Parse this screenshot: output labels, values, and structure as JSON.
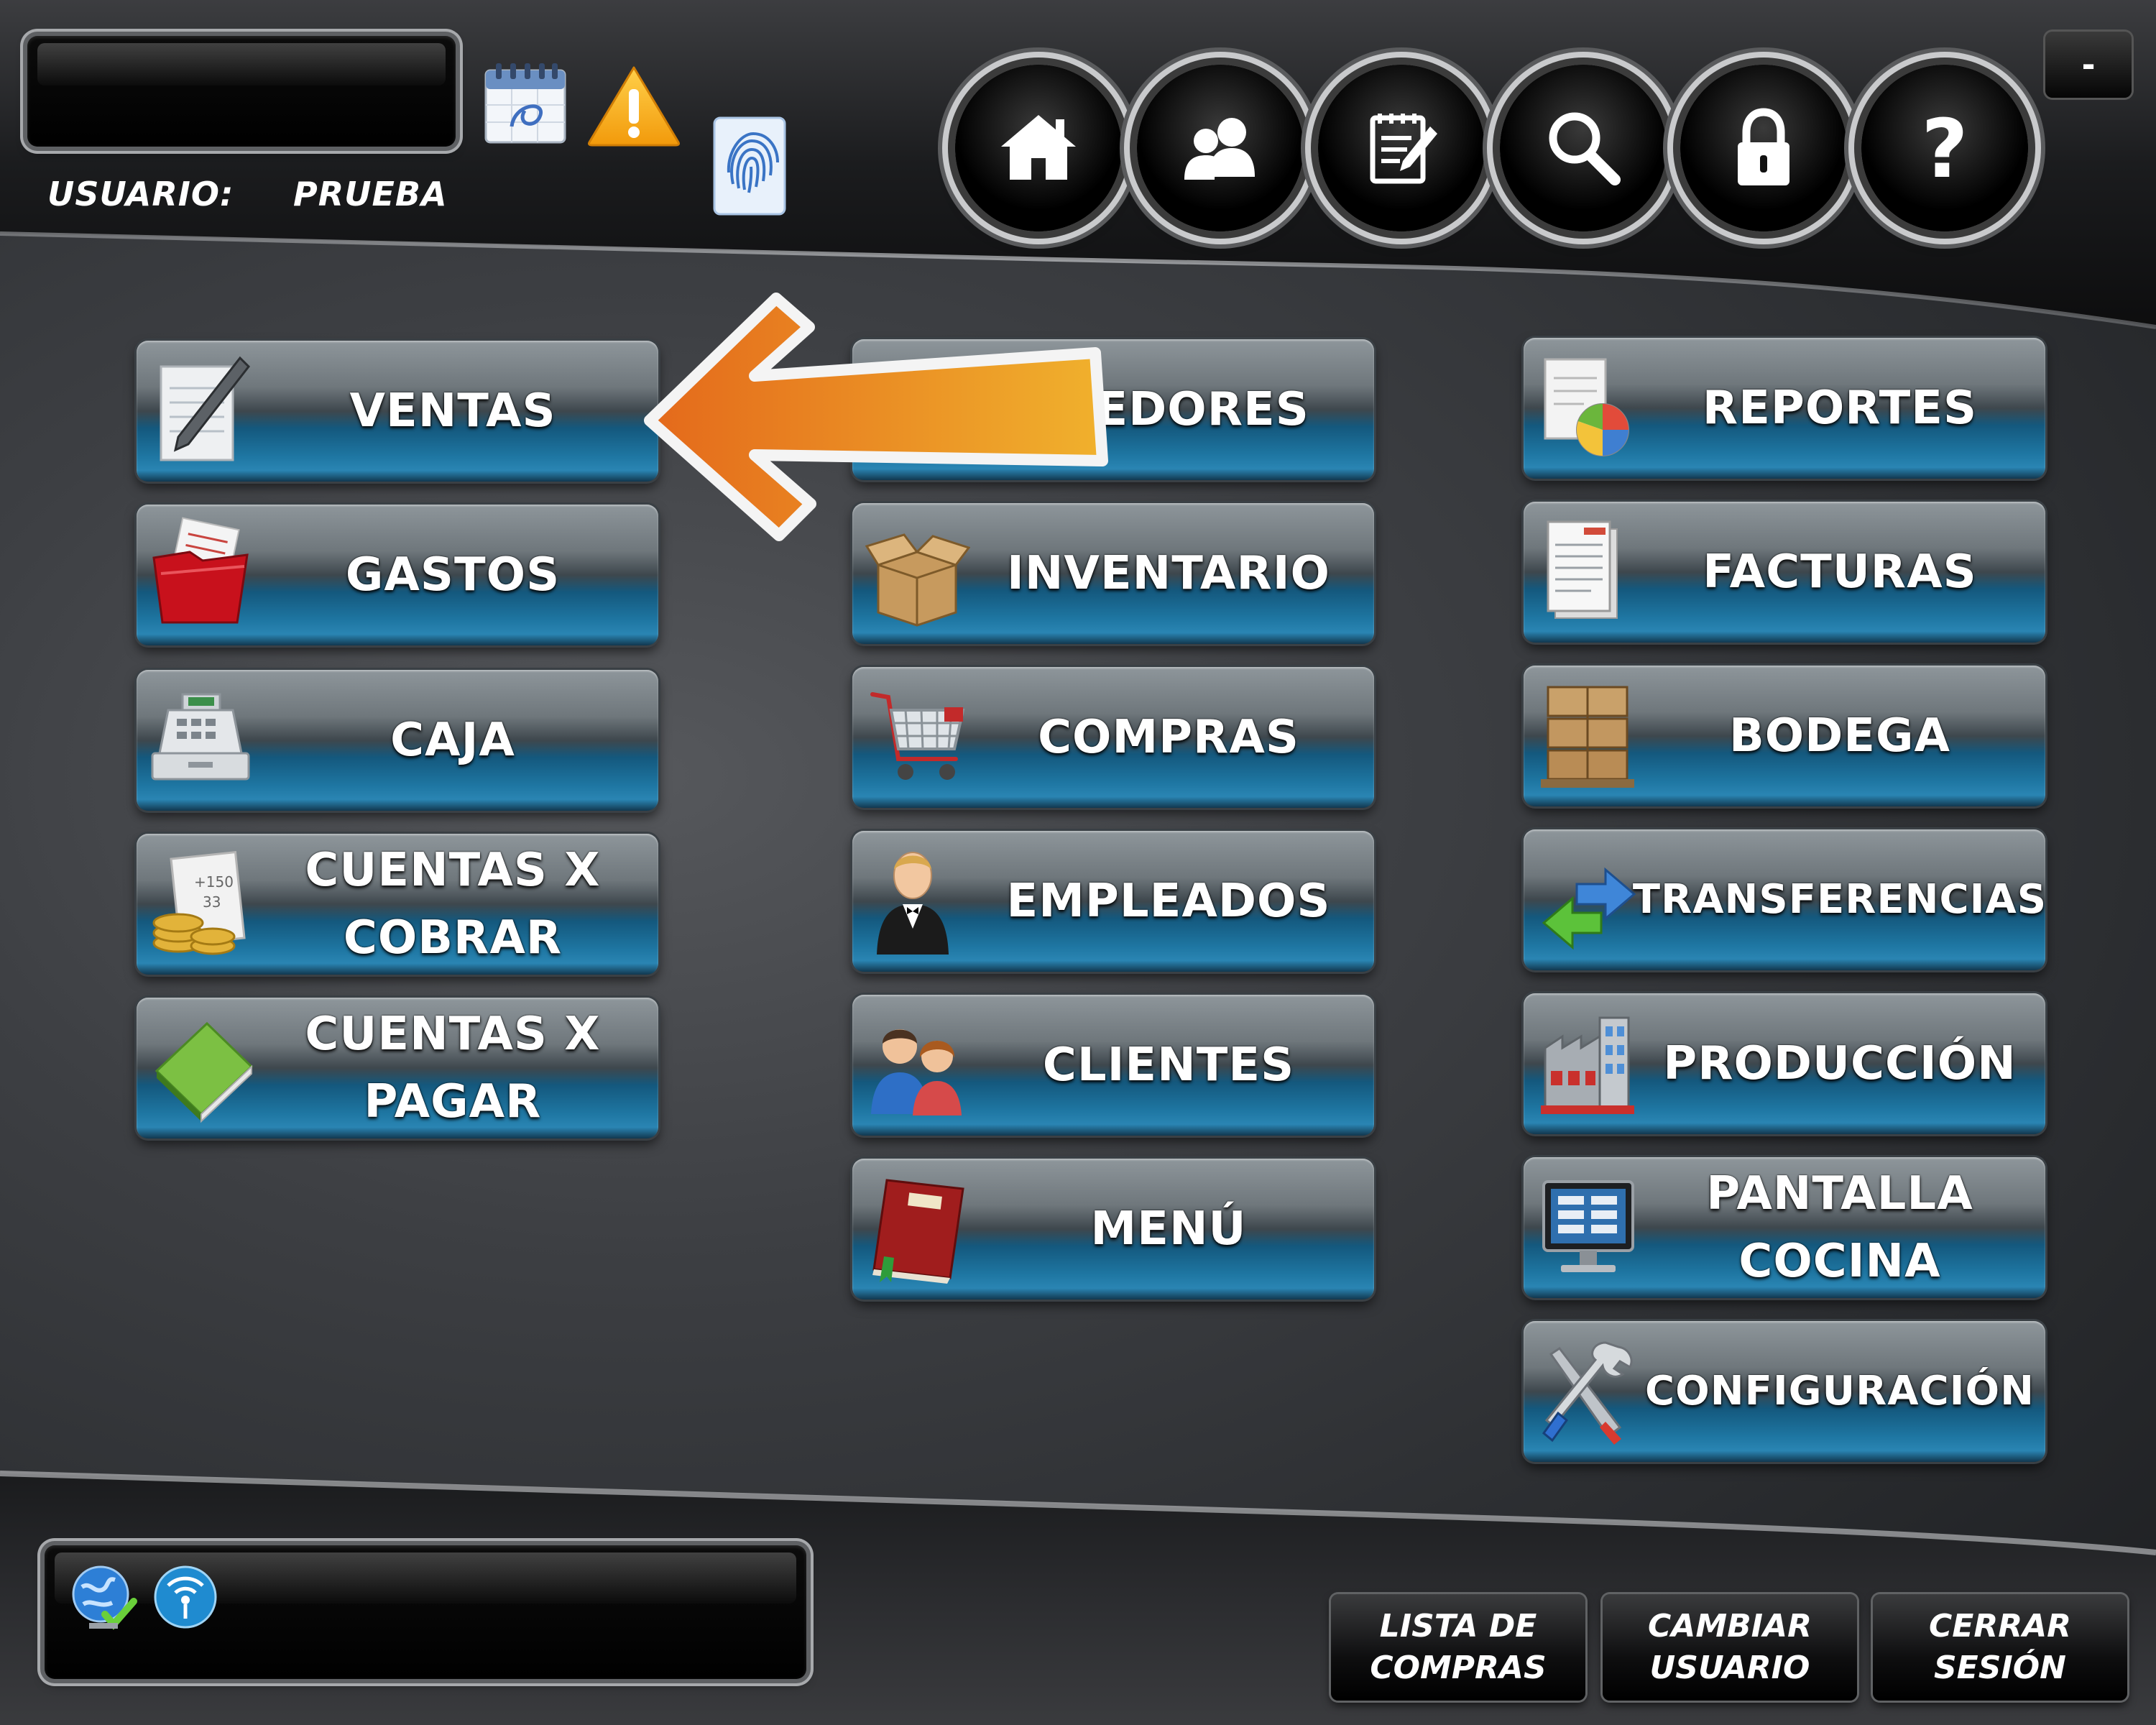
{
  "header": {
    "user_label": "USUARIO:",
    "user_name": "PRUEBA",
    "status_icons": [
      "calendar-icon",
      "warning-icon",
      "fingerprint-icon"
    ],
    "nav_buttons": [
      {
        "name": "home-icon"
      },
      {
        "name": "users-icon"
      },
      {
        "name": "notepad-icon"
      },
      {
        "name": "search-icon"
      },
      {
        "name": "lock-icon"
      },
      {
        "name": "help-icon"
      }
    ],
    "minimize_label": "-"
  },
  "menu": {
    "column1": [
      {
        "label": "VENTAS",
        "icon": "pen-document-icon"
      },
      {
        "label": "GASTOS",
        "icon": "red-folder-icon"
      },
      {
        "label": "CAJA",
        "icon": "cash-register-icon"
      },
      {
        "label": "CUENTAS X\nCOBRAR",
        "icon": "coins-receipt-icon"
      },
      {
        "label": "CUENTAS X\nPAGAR",
        "icon": "green-book-icon"
      }
    ],
    "column2": [
      {
        "label": "VEEDORES",
        "icon": "suppliers-icon"
      },
      {
        "label": "INVENTARIO",
        "icon": "box-icon"
      },
      {
        "label": "COMPRAS",
        "icon": "shopping-cart-icon"
      },
      {
        "label": "EMPLEADOS",
        "icon": "waiter-icon"
      },
      {
        "label": "CLIENTES",
        "icon": "customers-icon"
      },
      {
        "label": "MENÚ",
        "icon": "menu-book-icon"
      }
    ],
    "column3": [
      {
        "label": "REPORTES",
        "icon": "report-chart-icon"
      },
      {
        "label": "FACTURAS",
        "icon": "invoice-icon"
      },
      {
        "label": "BODEGA",
        "icon": "boxes-stack-icon"
      },
      {
        "label": "TRANSFERENCIAS",
        "icon": "transfer-arrows-icon"
      },
      {
        "label": "PRODUCCIÓN",
        "icon": "factory-icon"
      },
      {
        "label": "PANTALLA\nCOCINA",
        "icon": "monitor-icon"
      },
      {
        "label": "CONFIGURACIÓN",
        "icon": "tools-icon"
      }
    ]
  },
  "footer": {
    "status_icons": [
      "globe-check-icon",
      "wifi-signal-icon"
    ],
    "buttons": [
      {
        "label": "LISTA DE\nCOMPRAS"
      },
      {
        "label": "CAMBIAR\nUSUARIO"
      },
      {
        "label": "CERRAR\nSESIÓN"
      }
    ]
  },
  "overlay": {
    "arrow_color": "#e8861f"
  }
}
